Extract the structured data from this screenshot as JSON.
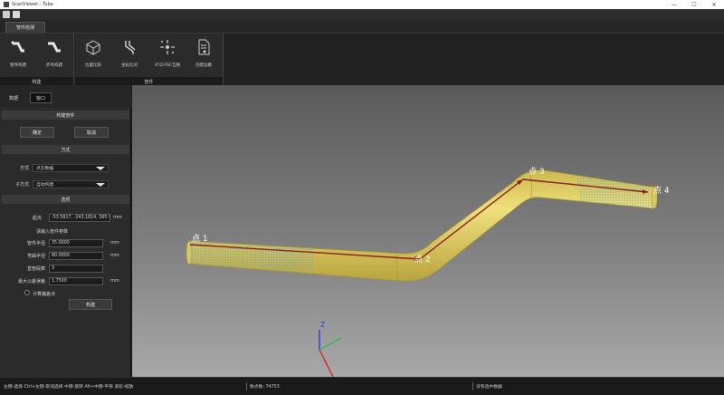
{
  "window": {
    "title": "ScanViewer - Tube",
    "minimize": "—",
    "maximize": "☐",
    "close": "✕"
  },
  "ribbon": {
    "tab": "管件检测",
    "groups": [
      {
        "label": "构建",
        "buttons": [
          "管件构建",
          "折弯构建"
        ]
      },
      {
        "label": "管件",
        "buttons": [
          "位置比较",
          "坐标比对",
          "XYZ/YBC互换",
          "创建边模"
        ]
      }
    ]
  },
  "panel": {
    "tabs": [
      "数据",
      "窗口"
    ],
    "sections": {
      "build": "构建管件",
      "method": "方式",
      "options": "选项"
    },
    "confirm_label": "确定",
    "cancel_label": "取消",
    "method_label": "方式",
    "method_value": "点云数据",
    "submethod_label": "子方式",
    "submethod_value": "自动构建",
    "start_label": "起点",
    "start_value": "-53.5817, -243.1814, 365.9",
    "start_unit": "mm",
    "hint": "请输入管件参数",
    "params": [
      {
        "label": "管件半径",
        "value": "35.0000",
        "unit": "mm"
      },
      {
        "label": "弯曲半径",
        "value": "80.0000",
        "unit": "mm"
      },
      {
        "label": "直管段数",
        "value": "3",
        "unit": ""
      },
      {
        "label": "最大公差误差",
        "value": "1.7500",
        "unit": "mm"
      }
    ],
    "checkbox_label": "计算偏差点",
    "build_button": "构建"
  },
  "viewport": {
    "points": [
      "点 1",
      "点 2",
      "点 3",
      "点 4"
    ],
    "axes": {
      "z": "Z",
      "x": "X",
      "y": "Y"
    },
    "colors": {
      "tube": "#e6d26a",
      "scan": "#4fa3d8",
      "path": "#8b1d1d",
      "axis_z": "#3a3adc",
      "axis_y": "#2fbf4a",
      "axis_x": "#d23030"
    }
  },
  "status": {
    "hint": "左键-选择 Ctrl+左键-取消选择 中键-旋转 Alt+中键-平移 滚轮-缩放",
    "count": "数点数: 74753",
    "selection": "没有选中数据"
  }
}
